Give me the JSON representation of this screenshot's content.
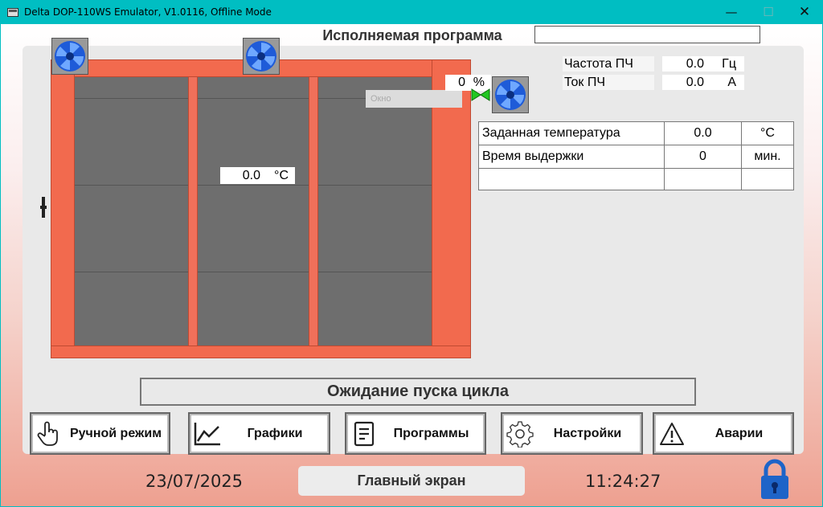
{
  "window": {
    "title": "Delta DOP-110WS Emulator, V1.0116, Offline Mode",
    "minimize": "—",
    "maximize": "☐",
    "close": "✕"
  },
  "program": {
    "title": "Исполняемая программа",
    "value": ""
  },
  "oven": {
    "temperature": "0.0",
    "temperature_unit": "°C",
    "valve_percent": "0",
    "valve_unit": "%",
    "ghost_label": "Окно"
  },
  "drive": {
    "frequency_label": "Частота ПЧ",
    "frequency_value": "0.0",
    "frequency_unit": "Гц",
    "current_label": "Ток ПЧ",
    "current_value": "0.0",
    "current_unit": "А"
  },
  "params": {
    "rows": [
      {
        "label": "Заданная температура",
        "value": "0.0",
        "unit": "°C"
      },
      {
        "label": "Время выдержки",
        "value": "0",
        "unit": "мин."
      },
      {
        "label": "",
        "value": "",
        "unit": ""
      }
    ]
  },
  "status": "Ожидание пуска цикла",
  "nav": {
    "manual": "Ручной режим",
    "graphs": "Графики",
    "programs": "Программы",
    "settings": "Настройки",
    "alarms": "Аварии"
  },
  "footer": {
    "date": "23/07/2025",
    "screen_name": "Главный экран",
    "time": "11:24:27"
  },
  "icons": {
    "fan": "fan-icon",
    "lock": "lock-icon",
    "hand": "hand-icon",
    "chart": "chart-icon",
    "document": "document-icon",
    "gear": "gear-icon",
    "warning": "warning-icon"
  },
  "colors": {
    "titlebar": "#00bec2",
    "oven_frame": "#f26a4e",
    "chamber": "#6e6e6e",
    "fan_blue": "#1e5bd8",
    "lock_blue": "#1e64c8"
  }
}
